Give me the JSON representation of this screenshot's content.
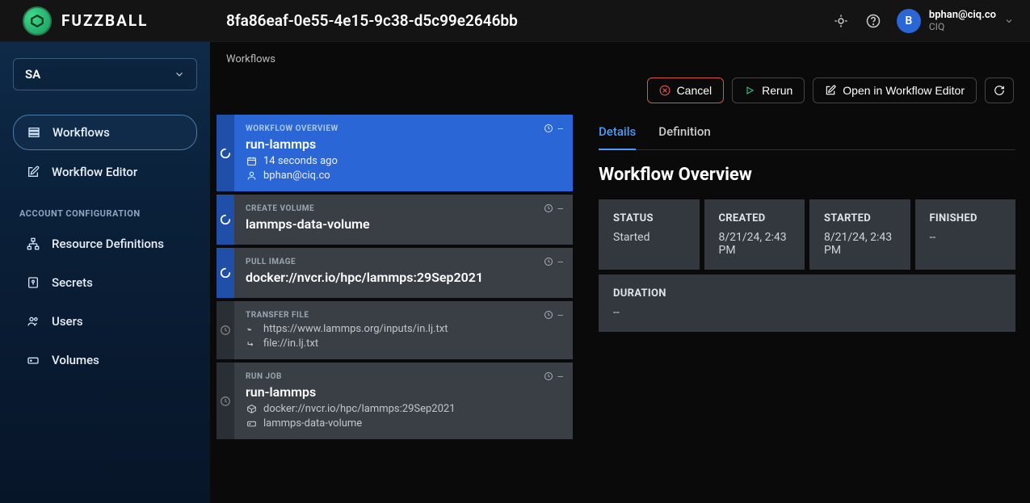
{
  "brand": "FUZZBALL",
  "page_title": "8fa86eaf-0e55-4e15-9c38-d5c99e2646bb",
  "user": {
    "avatar_initial": "B",
    "email": "bphan@ciq.co",
    "org": "CIQ"
  },
  "org_selector": {
    "value": "SA"
  },
  "sidebar": {
    "items": [
      {
        "label": "Workflows"
      },
      {
        "label": "Workflow Editor"
      }
    ],
    "section_header": "ACCOUNT CONFIGURATION",
    "config_items": [
      {
        "label": "Resource Definitions"
      },
      {
        "label": "Secrets"
      },
      {
        "label": "Users"
      },
      {
        "label": "Volumes"
      }
    ]
  },
  "breadcrumb": "Workflows",
  "actions": {
    "cancel": "Cancel",
    "rerun": "Rerun",
    "open_editor": "Open in Workflow Editor"
  },
  "steps": [
    {
      "type": "WORKFLOW OVERVIEW",
      "title": "run-lammps",
      "timer": "--",
      "meta": [
        {
          "icon": "calendar",
          "text": "14 seconds ago"
        },
        {
          "icon": "user",
          "text": "bphan@ciq.co"
        }
      ]
    },
    {
      "type": "CREATE VOLUME",
      "title": "lammps-data-volume",
      "timer": "--",
      "meta": []
    },
    {
      "type": "PULL IMAGE",
      "title": "docker://nvcr.io/hpc/lammps:29Sep2021",
      "timer": "--",
      "meta": []
    },
    {
      "type": "TRANSFER FILE",
      "title": "",
      "timer": "--",
      "meta": [
        {
          "icon": "arrow-down",
          "text": "https://www.lammps.org/inputs/in.lj.txt"
        },
        {
          "icon": "arrow-right",
          "text": "file://in.lj.txt"
        }
      ]
    },
    {
      "type": "RUN JOB",
      "title": "run-lammps",
      "timer": "--",
      "meta": [
        {
          "icon": "cube",
          "text": "docker://nvcr.io/hpc/lammps:29Sep2021"
        },
        {
          "icon": "disk",
          "text": "lammps-data-volume"
        }
      ]
    }
  ],
  "tabs": {
    "details": "Details",
    "definition": "Definition"
  },
  "details": {
    "heading": "Workflow Overview",
    "status_label": "STATUS",
    "status_value": "Started",
    "created_label": "CREATED",
    "created_value": "8/21/24, 2:43 PM",
    "started_label": "STARTED",
    "started_value": "8/21/24, 2:43 PM",
    "finished_label": "FINISHED",
    "finished_value": "--",
    "duration_label": "DURATION",
    "duration_value": "--"
  }
}
